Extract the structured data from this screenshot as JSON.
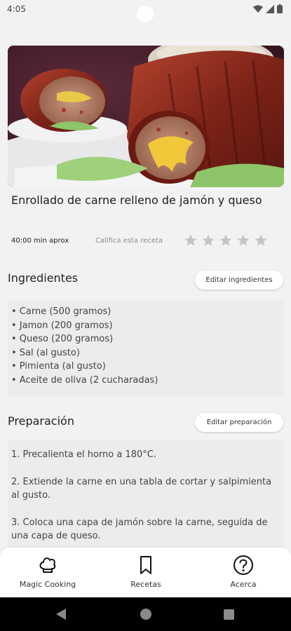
{
  "status_bar": {
    "time": "4:05"
  },
  "recipe": {
    "title": "Enrollado de carne relleno de jamón y queso",
    "time": "40:00 min aprox",
    "rate_label": "Califica esta receta",
    "rating": 0,
    "rating_max": 5
  },
  "ingredients": {
    "heading": "Ingredientes",
    "edit_label": "Editar ingredientes",
    "items": [
      "• Carne (500 gramos)",
      "• Jamon (200 gramos)",
      "• Queso (200 gramos)",
      "• Sal (al gusto)",
      "• Pimienta (al gusto)",
      "• Aceite de oliva (2 cucharadas)"
    ]
  },
  "preparation": {
    "heading": "Preparación",
    "edit_label": "Editar preparación",
    "steps": [
      "1. Precalienta el horno a 180°C.",
      "2. Extiende la carne en una tabla de cortar y salpimienta al gusto.",
      "3. Coloca una capa de jamón sobre la carne, seguida de una capa de queso."
    ]
  },
  "bottom_nav": {
    "items": [
      {
        "label": "Magic Cooking",
        "icon": "chef-hat-icon"
      },
      {
        "label": "Recetas",
        "icon": "bookmark-icon"
      },
      {
        "label": "Acerca",
        "icon": "help-circle-icon"
      }
    ]
  },
  "colors": {
    "background": "#f2f2f2",
    "card": "#ececec",
    "star_empty": "#c4c4c4"
  }
}
